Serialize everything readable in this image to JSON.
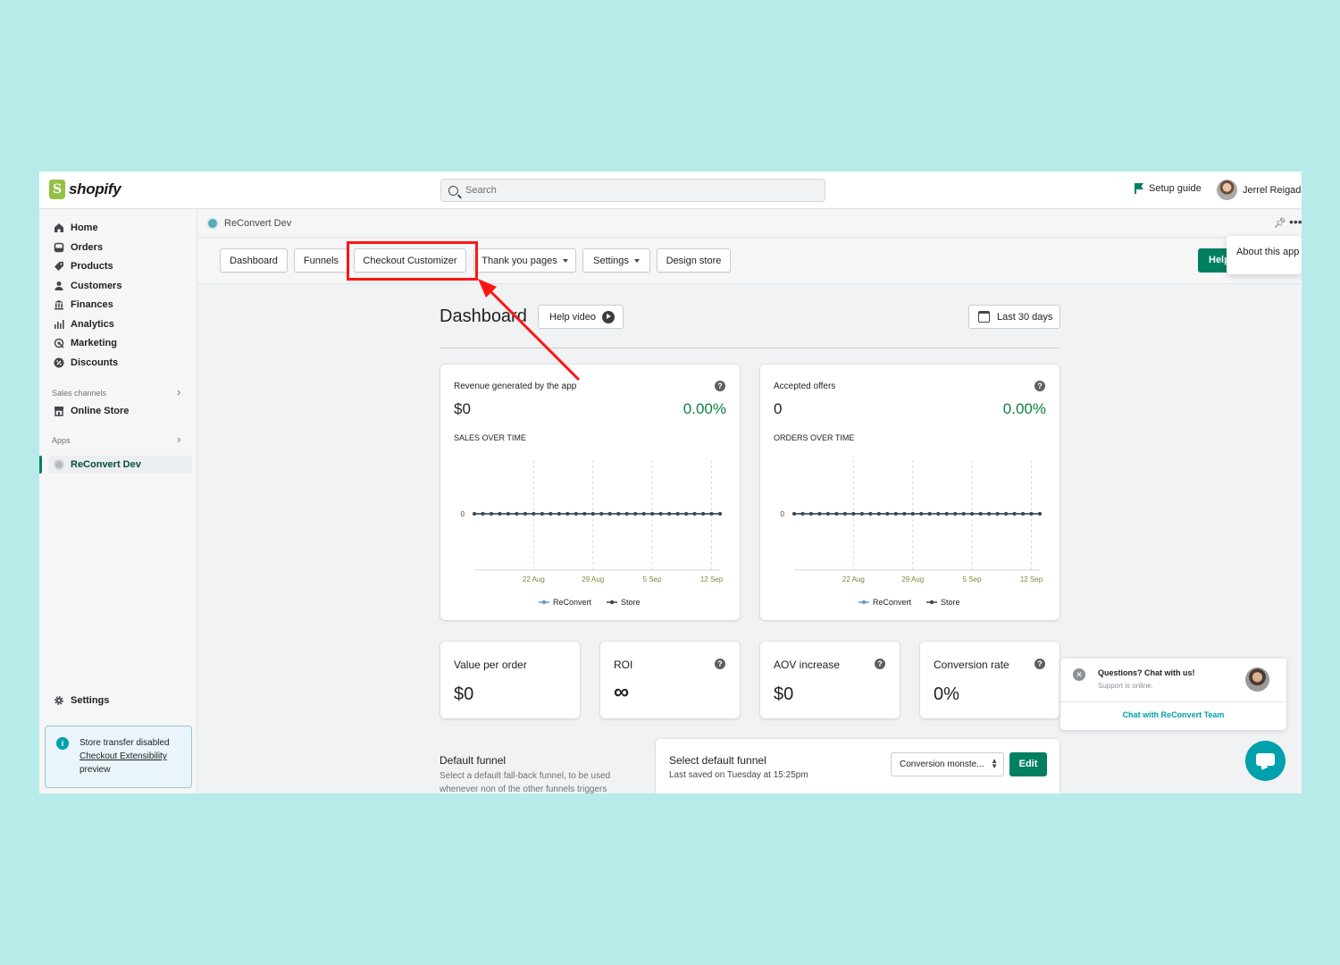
{
  "topbar": {
    "brand": "shopify",
    "search_placeholder": "Search",
    "setup_guide": "Setup guide",
    "user_name": "Jerrel Reigada"
  },
  "sidebar": {
    "items": [
      {
        "label": "Home",
        "icon": "home-icon"
      },
      {
        "label": "Orders",
        "icon": "orders-icon"
      },
      {
        "label": "Products",
        "icon": "tag-icon"
      },
      {
        "label": "Customers",
        "icon": "person-icon"
      },
      {
        "label": "Finances",
        "icon": "bank-icon"
      },
      {
        "label": "Analytics",
        "icon": "bar-chart-icon"
      },
      {
        "label": "Marketing",
        "icon": "target-icon"
      },
      {
        "label": "Discounts",
        "icon": "discount-icon"
      }
    ],
    "sales_channels_label": "Sales channels",
    "online_store": "Online Store",
    "apps_label": "Apps",
    "active_app": "ReConvert Dev",
    "settings": "Settings",
    "notice": {
      "line1": "Store transfer disabled",
      "link": "Checkout Extensibility",
      "line2": "preview"
    }
  },
  "appbar": {
    "title": "ReConvert Dev",
    "about": "About this app",
    "help_button": "Help"
  },
  "toolbar": {
    "tabs": [
      "Dashboard",
      "Funnels",
      "Checkout Customizer",
      "Thank you pages",
      "Settings",
      "Design store"
    ]
  },
  "dashboard": {
    "title": "Dashboard",
    "help_video": "Help video",
    "date_range": "Last 30 days",
    "revenue_card": {
      "label": "Revenue generated by the app",
      "value": "$0",
      "percent": "0.00%",
      "sub_label": "SALES OVER TIME"
    },
    "offers_card": {
      "label": "Accepted offers",
      "value": "0",
      "percent": "0.00%",
      "sub_label": "ORDERS OVER TIME"
    },
    "stats": [
      {
        "label": "Value per order",
        "value": "$0"
      },
      {
        "label": "ROI",
        "value": "∞"
      },
      {
        "label": "AOV increase",
        "value": "$0"
      },
      {
        "label": "Conversion rate",
        "value": "0%"
      }
    ],
    "default_funnel": {
      "title": "Default funnel",
      "description": "Select a default fall-back funnel, to be used whenever non of the other funnels triggers",
      "select_title": "Select default funnel",
      "last_saved": "Last saved on Tuesday at 15:25pm",
      "selected": "Conversion monste...",
      "edit": "Edit"
    }
  },
  "chat": {
    "question": "Questions? Chat with us!",
    "status": "Support is online.",
    "link": "Chat with ReConvert Team"
  },
  "colors": {
    "accent_green": "#008060",
    "highlight_red": "#ff1414",
    "series_reconvert": "#5b9bd5",
    "series_store": "#3c4651",
    "percent_green": "#108043"
  },
  "chart_data": [
    {
      "type": "line",
      "sub_label": "SALES OVER TIME",
      "x_ticks": [
        "22 Aug",
        "29 Aug",
        "5 Sep",
        "12 Sep"
      ],
      "y_ticks": [
        "0"
      ],
      "series": [
        {
          "name": "ReConvert",
          "values": [
            0,
            0,
            0,
            0,
            0,
            0,
            0,
            0,
            0,
            0,
            0,
            0,
            0,
            0,
            0,
            0,
            0,
            0,
            0,
            0,
            0,
            0,
            0,
            0,
            0,
            0,
            0,
            0,
            0,
            0
          ]
        },
        {
          "name": "Store",
          "values": [
            0,
            0,
            0,
            0,
            0,
            0,
            0,
            0,
            0,
            0,
            0,
            0,
            0,
            0,
            0,
            0,
            0,
            0,
            0,
            0,
            0,
            0,
            0,
            0,
            0,
            0,
            0,
            0,
            0,
            0
          ]
        }
      ]
    },
    {
      "type": "line",
      "sub_label": "ORDERS OVER TIME",
      "x_ticks": [
        "22 Aug",
        "29 Aug",
        "5 Sep",
        "12 Sep"
      ],
      "y_ticks": [
        "0"
      ],
      "series": [
        {
          "name": "ReConvert",
          "values": [
            0,
            0,
            0,
            0,
            0,
            0,
            0,
            0,
            0,
            0,
            0,
            0,
            0,
            0,
            0,
            0,
            0,
            0,
            0,
            0,
            0,
            0,
            0,
            0,
            0,
            0,
            0,
            0,
            0,
            0
          ]
        },
        {
          "name": "Store",
          "values": [
            0,
            0,
            0,
            0,
            0,
            0,
            0,
            0,
            0,
            0,
            0,
            0,
            0,
            0,
            0,
            0,
            0,
            0,
            0,
            0,
            0,
            0,
            0,
            0,
            0,
            0,
            0,
            0,
            0,
            0
          ]
        }
      ]
    }
  ]
}
